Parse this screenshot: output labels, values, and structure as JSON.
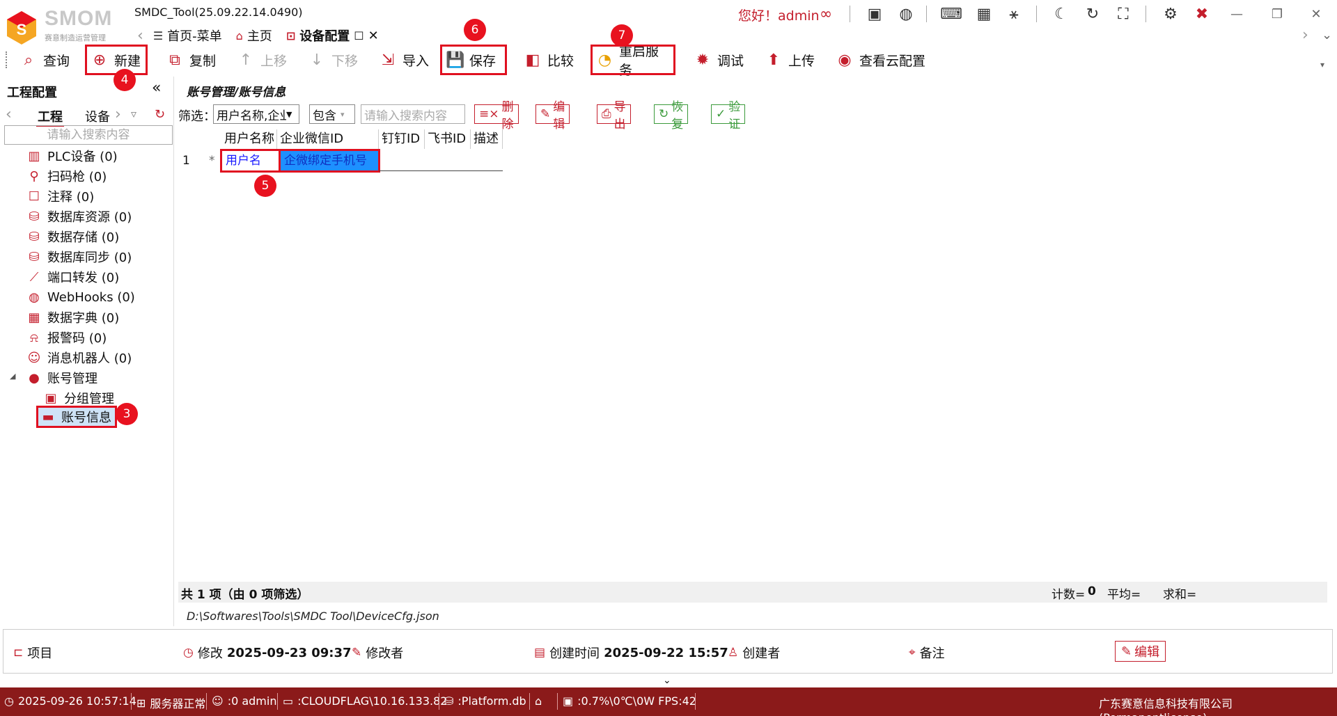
{
  "app": {
    "title": "SMDC_Tool(25.09.22.14.0490)",
    "logo_text": "SMOM",
    "logo_sub": "赛意制造运营管理",
    "greeting": "您好！admin"
  },
  "tabs": [
    {
      "label": "首页-菜单",
      "icon": "menu-icon"
    },
    {
      "label": "主页",
      "icon": "home-icon"
    },
    {
      "label": "设备配置",
      "icon": "config-icon",
      "active": true
    }
  ],
  "toolbar": {
    "query": "查询",
    "new": "新建",
    "copy": "复制",
    "move_up": "上移",
    "move_down": "下移",
    "import": "导入",
    "save": "保存",
    "compare": "比较",
    "restart": "重启服务",
    "debug": "调试",
    "upload": "上传",
    "view_cloud": "查看云配置"
  },
  "markers": {
    "m3": "3",
    "m4": "4",
    "m5": "5",
    "m6": "6",
    "m7": "7"
  },
  "left_panel": {
    "title": "工程配置",
    "tab_project": "工程",
    "tab_device": "设备",
    "search_placeholder": "请输入搜索内容",
    "items": [
      {
        "label": "PLC设备 (0)",
        "icon": "plc-icon"
      },
      {
        "label": "扫码枪 (0)",
        "icon": "scanner-icon"
      },
      {
        "label": "注释 (0)",
        "icon": "comment-icon"
      },
      {
        "label": "数据库资源 (0)",
        "icon": "database-icon"
      },
      {
        "label": "数据存储 (0)",
        "icon": "storage-icon"
      },
      {
        "label": "数据库同步 (0)",
        "icon": "sync-icon"
      },
      {
        "label": "端口转发 (0)",
        "icon": "port-icon"
      },
      {
        "label": "WebHooks (0)",
        "icon": "globe-icon"
      },
      {
        "label": "数据字典 (0)",
        "icon": "table-icon"
      },
      {
        "label": "报警码 (0)",
        "icon": "alarm-icon"
      },
      {
        "label": "消息机器人 (0)",
        "icon": "robot-icon"
      },
      {
        "label": "账号管理",
        "icon": "user-icon"
      },
      {
        "label": "分组管理",
        "icon": "group-icon"
      },
      {
        "label": "账号信息",
        "icon": "account-info-icon"
      }
    ]
  },
  "main": {
    "breadcrumb": "账号管理/账号信息",
    "filter_label": "筛选：",
    "filter_field": "用户名称,企业",
    "filter_op": "包含",
    "filter_placeholder": "请输入搜索内容",
    "btn_delete": "删除",
    "btn_edit": "编辑",
    "btn_export": "导出",
    "btn_restore": "恢复",
    "btn_verify": "验证",
    "columns": [
      "用户名称",
      "企业微信ID",
      "钉钉ID",
      "飞书ID",
      "描述"
    ],
    "row_num": "1",
    "row_marker": "*",
    "row": {
      "username": "用户名",
      "wecom": "企微绑定手机号"
    },
    "summary": "共 1 项（由 0 项筛选）",
    "count_label": "计数=",
    "count_value": "0",
    "avg_label": "平均=",
    "sum_label": "求和=",
    "path": "D:\\Softwares\\Tools\\SMDC Tool\\DeviceCfg.json"
  },
  "footer": {
    "project": "项目",
    "modified_label": "修改",
    "modified_value": "2025-09-23 09:37",
    "modifier_label": "修改者",
    "created_label": "创建时间",
    "created_value": "2025-09-22 15:57",
    "creator_label": "创建者",
    "note_label": "备注",
    "edit_btn": "编辑"
  },
  "status": {
    "time": "2025-09-26 10:57:14",
    "server": "服务器正常",
    "user": ":0 admin",
    "host": ":CLOUDFLAG\\10.16.133.82",
    "db": ":Platform.db",
    "perf": ":0.7%\\0℃\\0W  FPS:42",
    "company": "广东赛意信息科技有限公司(Permanentlicense)"
  },
  "colors": {
    "accent": "#c41e2c",
    "status_bg": "#8b1a1a",
    "highlight": "#e01020",
    "selection": "#1e90ff"
  }
}
